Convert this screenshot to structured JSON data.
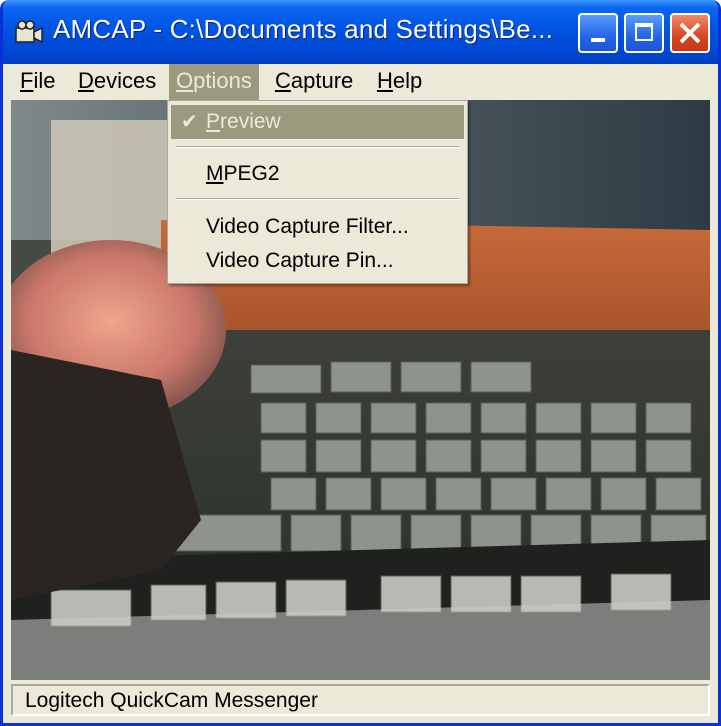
{
  "window": {
    "title": "AMCAP - C:\\Documents and Settings\\Be...",
    "icon": "video-camera-icon",
    "buttons": {
      "minimize": "minimize-icon",
      "maximize": "maximize-icon",
      "close": "close-icon"
    }
  },
  "menubar": [
    {
      "label_ul": "F",
      "label_rest": "ile"
    },
    {
      "label_ul": "D",
      "label_rest": "evices"
    },
    {
      "label_ul": "O",
      "label_rest": "ptions"
    },
    {
      "label_ul": "C",
      "label_rest": "apture"
    },
    {
      "label_ul": "H",
      "label_rest": "elp"
    }
  ],
  "options_menu": {
    "items": [
      {
        "label_ul": "P",
        "label_rest": "review",
        "checked": true,
        "check_glyph": "✔"
      },
      {
        "label_ul": "M",
        "label_rest": "PEG2"
      },
      {
        "label": "Video Capture Filter..."
      },
      {
        "label": "Video Capture Pin..."
      }
    ]
  },
  "status": {
    "text": "Logitech QuickCam Messenger"
  },
  "colors": {
    "title_blue": "#0054e3",
    "menu_highlight": "#9b9a7e",
    "chrome": "#ece9d8"
  }
}
